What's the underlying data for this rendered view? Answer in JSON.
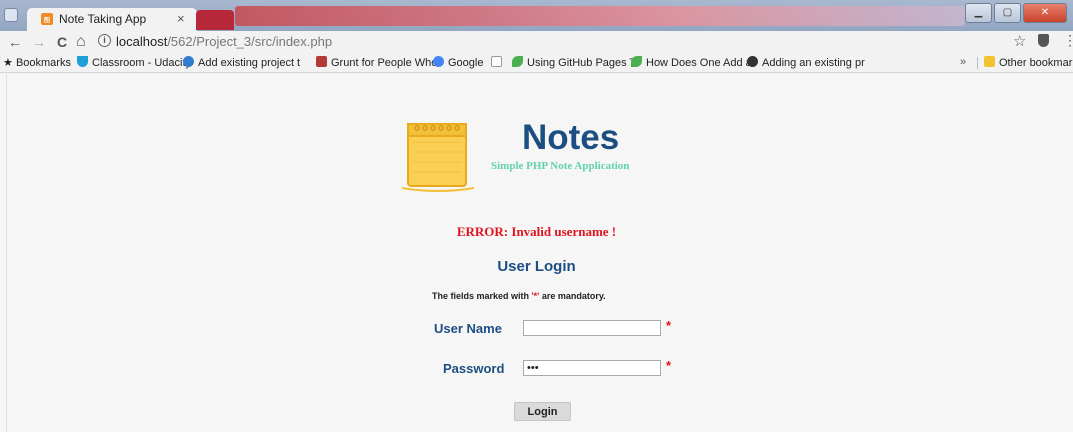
{
  "browser": {
    "tab_title": "Note Taking App",
    "tab_close": "×",
    "window_buttons": [
      "▁",
      "▢",
      "✕"
    ],
    "nav": {
      "back": "←",
      "forward": "→",
      "reload": "C",
      "home": "⌂"
    },
    "url_host": "localhost",
    "url_path": "/562/Project_3/src/index.php",
    "bookmarks": [
      {
        "label": "Bookmarks",
        "icon": "star-icon"
      },
      {
        "label": "Classroom - Udacity",
        "icon": "udacity-icon",
        "color": "#1ea0d6"
      },
      {
        "label": "Add existing project t",
        "icon": "cloud-icon",
        "color": "#2f7dd1"
      },
      {
        "label": "Grunt for People Who",
        "icon": "grunt-icon",
        "color": "#b43a3a"
      },
      {
        "label": "Google",
        "icon": "google-icon",
        "color": "#4285f4"
      },
      {
        "label": "",
        "icon": "page-icon",
        "color": "#999999"
      },
      {
        "label": "Using GitHub Pages T",
        "icon": "leaf-icon",
        "color": "#4caf50"
      },
      {
        "label": "How Does One Add a",
        "icon": "leaf-icon",
        "color": "#4caf50"
      },
      {
        "label": "Adding an existing pr",
        "icon": "github-icon",
        "color": "#333333"
      }
    ],
    "bookmarks_overflow": "»",
    "other_bookmarks": "Other bookmarks"
  },
  "app": {
    "title": "Notes",
    "subtitle": "Simple PHP Note Application"
  },
  "login": {
    "error": "ERROR: Invalid username !",
    "heading": "User Login",
    "hint_prefix": "The fields marked with ",
    "hint_marker": "'*'",
    "hint_suffix": " are mandatory.",
    "username_label": "User Name",
    "username_value": "",
    "password_label": "Password",
    "password_value": "•••",
    "required_mark": "*",
    "submit_label": "Login"
  },
  "colors": {
    "brand": "#1d4e82",
    "error": "#e0141e",
    "subtitle": "#62d1b0",
    "notepad": "#f0b82a"
  }
}
